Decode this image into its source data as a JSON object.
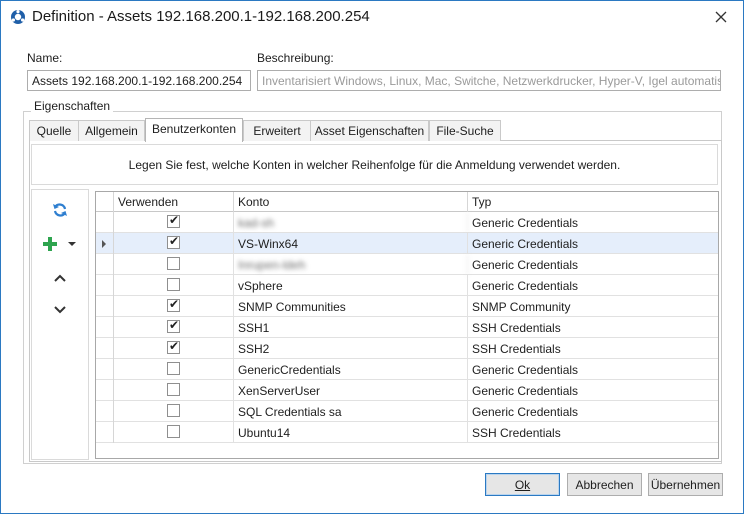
{
  "window": {
    "title": "Definition - Assets 192.168.200.1-192.168.200.254",
    "accent_color": "#2b79c2"
  },
  "fields": {
    "name_label": "Name:",
    "name_value": "Assets 192.168.200.1-192.168.200.254",
    "description_label": "Beschreibung:",
    "description_value": "Inventarisiert Windows, Linux, Mac, Switche, Netzwerkdrucker, Hyper-V, Igel automatisch"
  },
  "groupbox": {
    "label": "Eigenschaften"
  },
  "tabs": [
    {
      "label": "Quelle",
      "active": false
    },
    {
      "label": "Allgemein",
      "active": false
    },
    {
      "label": "Benutzerkonten",
      "active": true
    },
    {
      "label": "Erweitert",
      "active": false
    },
    {
      "label": "Asset Eigenschaften",
      "active": false
    },
    {
      "label": "File-Suche",
      "active": false
    }
  ],
  "info_text": "Legen Sie fest, welche Konten in welcher Reihenfolge für die Anmeldung verwendet werden.",
  "sidebar": {
    "icons": [
      "refresh-icon",
      "add-icon",
      "dropdown-arrow-icon",
      "move-up-icon",
      "move-down-icon"
    ]
  },
  "grid": {
    "columns": [
      "Verwenden",
      "Konto",
      "Typ"
    ],
    "rows": [
      {
        "use": true,
        "account": "kad-sh",
        "type": "Generic Credentials",
        "redacted": true,
        "selected": false
      },
      {
        "use": true,
        "account": "VS-Winx64",
        "type": "Generic Credentials",
        "redacted": false,
        "selected": true
      },
      {
        "use": false,
        "account": "Inrupen-ldeh",
        "type": "Generic Credentials",
        "redacted": true,
        "selected": false
      },
      {
        "use": false,
        "account": "vSphere",
        "type": "Generic Credentials",
        "redacted": false,
        "selected": false
      },
      {
        "use": true,
        "account": "SNMP Communities",
        "type": "SNMP Community",
        "redacted": false,
        "selected": false
      },
      {
        "use": true,
        "account": "SSH1",
        "type": "SSH Credentials",
        "redacted": false,
        "selected": false
      },
      {
        "use": true,
        "account": "SSH2",
        "type": "SSH Credentials",
        "redacted": false,
        "selected": false
      },
      {
        "use": false,
        "account": "GenericCredentials",
        "type": "Generic Credentials",
        "redacted": false,
        "selected": false
      },
      {
        "use": false,
        "account": "XenServerUser",
        "type": "Generic Credentials",
        "redacted": false,
        "selected": false
      },
      {
        "use": false,
        "account": "SQL Credentials sa",
        "type": "Generic Credentials",
        "redacted": false,
        "selected": false
      },
      {
        "use": false,
        "account": "Ubuntu14",
        "type": "SSH Credentials",
        "redacted": false,
        "selected": false
      }
    ]
  },
  "buttons": {
    "ok": "Ok",
    "cancel": "Abbrechen",
    "apply": "Übernehmen"
  }
}
